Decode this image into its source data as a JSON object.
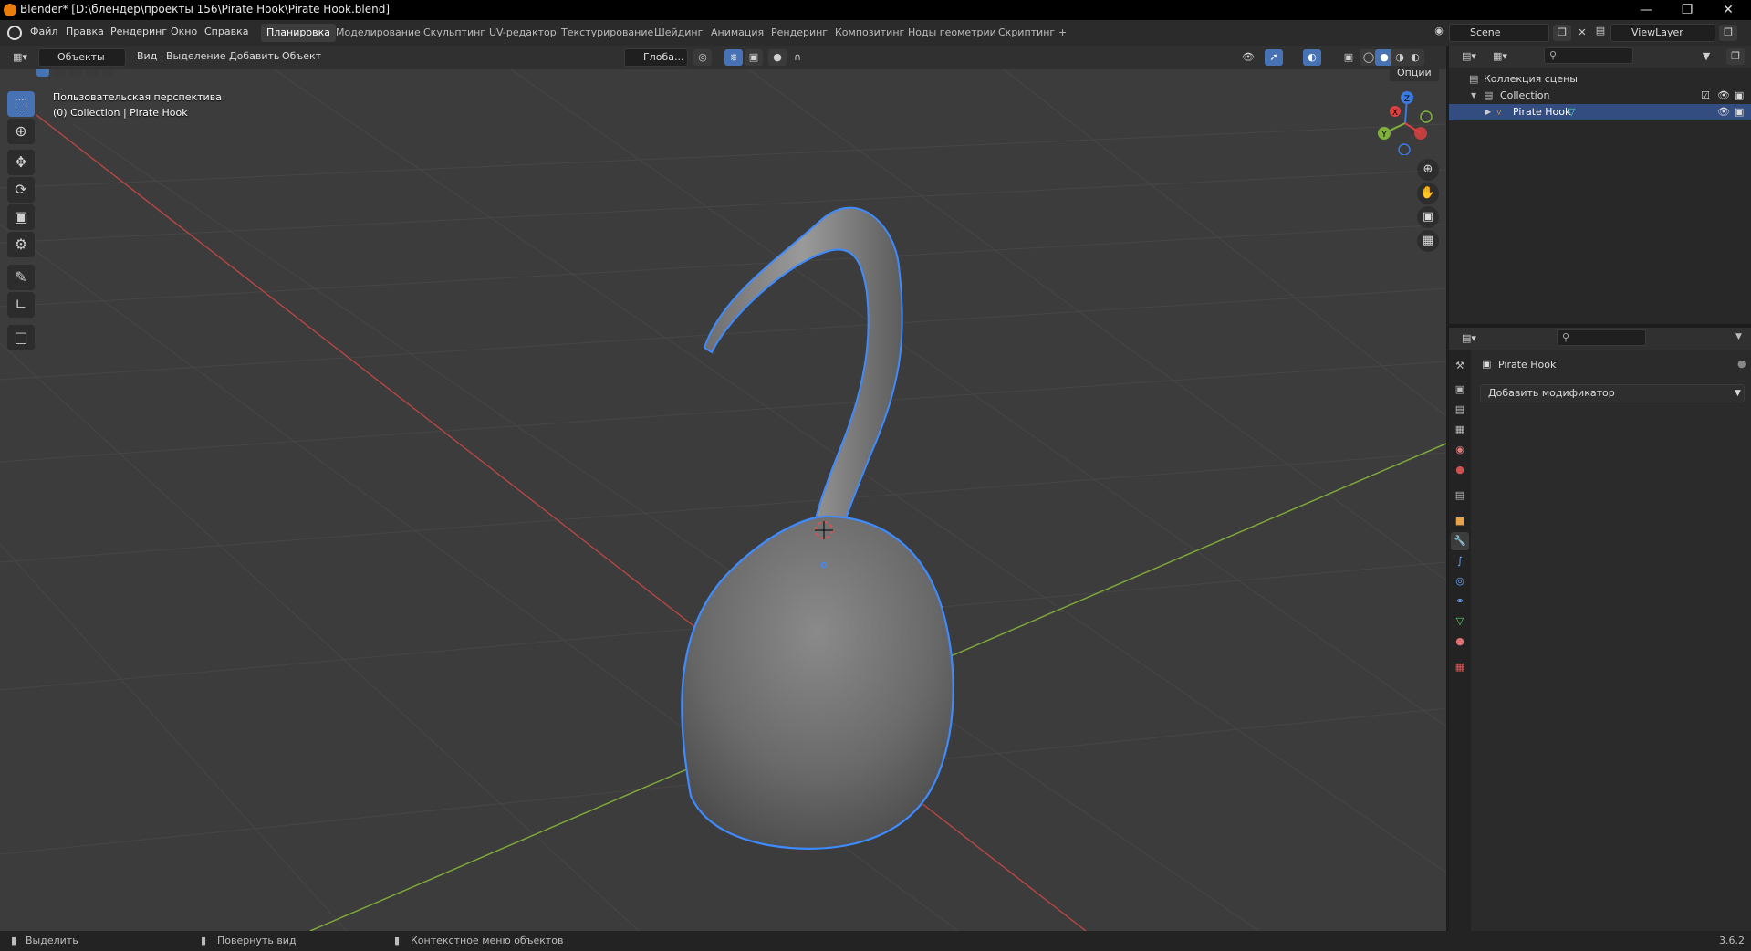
{
  "window": {
    "title": "Blender* [D:\\блендер\\проекты 156\\Pirate Hook\\Pirate Hook.blend]",
    "minimize_icon": "minimize-icon",
    "maximize_icon": "restore-icon",
    "close_icon": "close-icon"
  },
  "menu": [
    "Файл",
    "Правка",
    "Рендеринг",
    "Окно",
    "Справка"
  ],
  "workspaces": [
    "Планировка",
    "Моделирование",
    "Скульптинг",
    "UV-редактор",
    "Текстурирование",
    "Шейдинг",
    "Анимация",
    "Рендеринг",
    "Композитинг",
    "Ноды геометрии",
    "Скриптинг",
    "+"
  ],
  "active_workspace": "Планировка",
  "scene": {
    "name": "Scene"
  },
  "view_layer": {
    "name": "ViewLayer"
  },
  "viewport_header": {
    "mode": "Объекты",
    "menus": [
      "Вид",
      "Выделение",
      "Добавить",
      "Объект"
    ],
    "orientation": "Глоба...",
    "options": "Опции"
  },
  "viewport_overlay": {
    "view_name": "Пользовательская перспектива",
    "collection_info": "(0) Collection | Pirate Hook"
  },
  "gizmo": {
    "z": "Z",
    "y": "Y",
    "x": "X"
  },
  "tools": [
    "select-box-icon",
    "cursor-icon",
    "move-icon",
    "rotate-icon",
    "scale-icon",
    "transform-icon",
    "annotate-icon",
    "measure-icon",
    "add-cube-icon"
  ],
  "outliner": {
    "scene_collection": "Коллекция сцены",
    "collection": "Collection",
    "object": "Pirate Hook"
  },
  "properties": {
    "object_name": "Pirate Hook",
    "add_modifier": "Добавить модификатор"
  },
  "statusbar": {
    "select": "Выделить",
    "rotate": "Повернуть вид",
    "context_menu": "Контекстное меню объектов",
    "version": "3.6.2"
  },
  "colors": {
    "selection": "#4772b3",
    "axis_x": "#e14040",
    "axis_y": "#8ac43c",
    "outline": "#3e8bff"
  }
}
